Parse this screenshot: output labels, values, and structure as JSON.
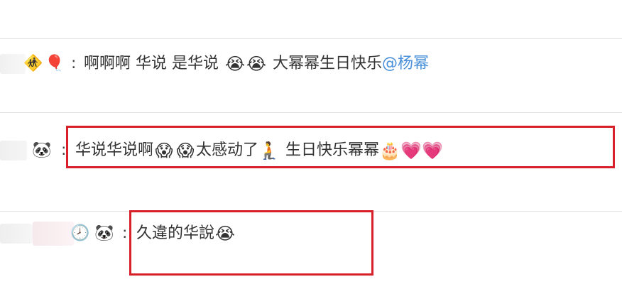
{
  "comments": [
    {
      "user_badges": [
        "children-crossing-icon",
        "balloon-icon"
      ],
      "colon": ":",
      "text_1": "啊啊啊 华说 是华说",
      "emojis_1": [
        "😭",
        "😭"
      ],
      "text_2": "大幂幂生日快乐",
      "mention": "@杨幂"
    },
    {
      "user_badges": [
        "panda-icon"
      ],
      "colon": ":",
      "text_1": "华说华说啊",
      "emojis_1": [
        "😱",
        "😱"
      ],
      "text_2": "太感动了",
      "emoji_2": "🧎",
      "text_3": "生日快乐幂幂",
      "emojis_3": [
        "🎂",
        "💗",
        "💗"
      ]
    },
    {
      "user_badges": [
        "clock-icon",
        "panda-icon"
      ],
      "colon": ":",
      "text_1": "久違的华說",
      "emojis_1": [
        "😭"
      ]
    }
  ],
  "colors": {
    "highlight_box": "#d8202a",
    "mention": "#4a90d9",
    "divider": "#e3e3e3"
  }
}
